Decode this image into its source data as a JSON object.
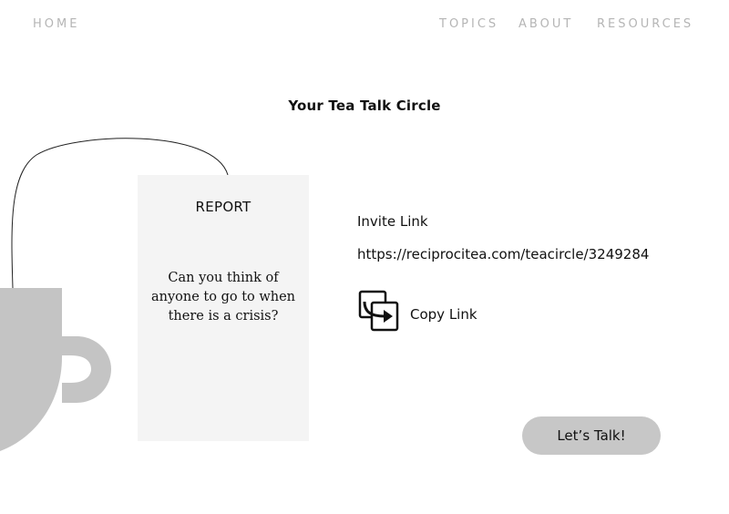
{
  "nav": {
    "home": "HOME",
    "topics": "TOPICS",
    "about": "ABOUT",
    "resources": "RESOURCES"
  },
  "page_title": "Your Tea Talk Circle",
  "card": {
    "title": "REPORT",
    "question": "Can you think of anyone to go to when there is a crisis?"
  },
  "invite": {
    "label": "Invite Link",
    "url": "https://reciprocitea.com/teacircle/3249284"
  },
  "copy": {
    "label": "Copy Link",
    "icon": "copy-link-icon"
  },
  "cta": {
    "label": "Let’s Talk!"
  },
  "colors": {
    "nav_text": "#b5b5b5",
    "cup": "#c4c4c4",
    "card_bg": "#f4f4f4",
    "button_bg": "#c7c7c7"
  }
}
